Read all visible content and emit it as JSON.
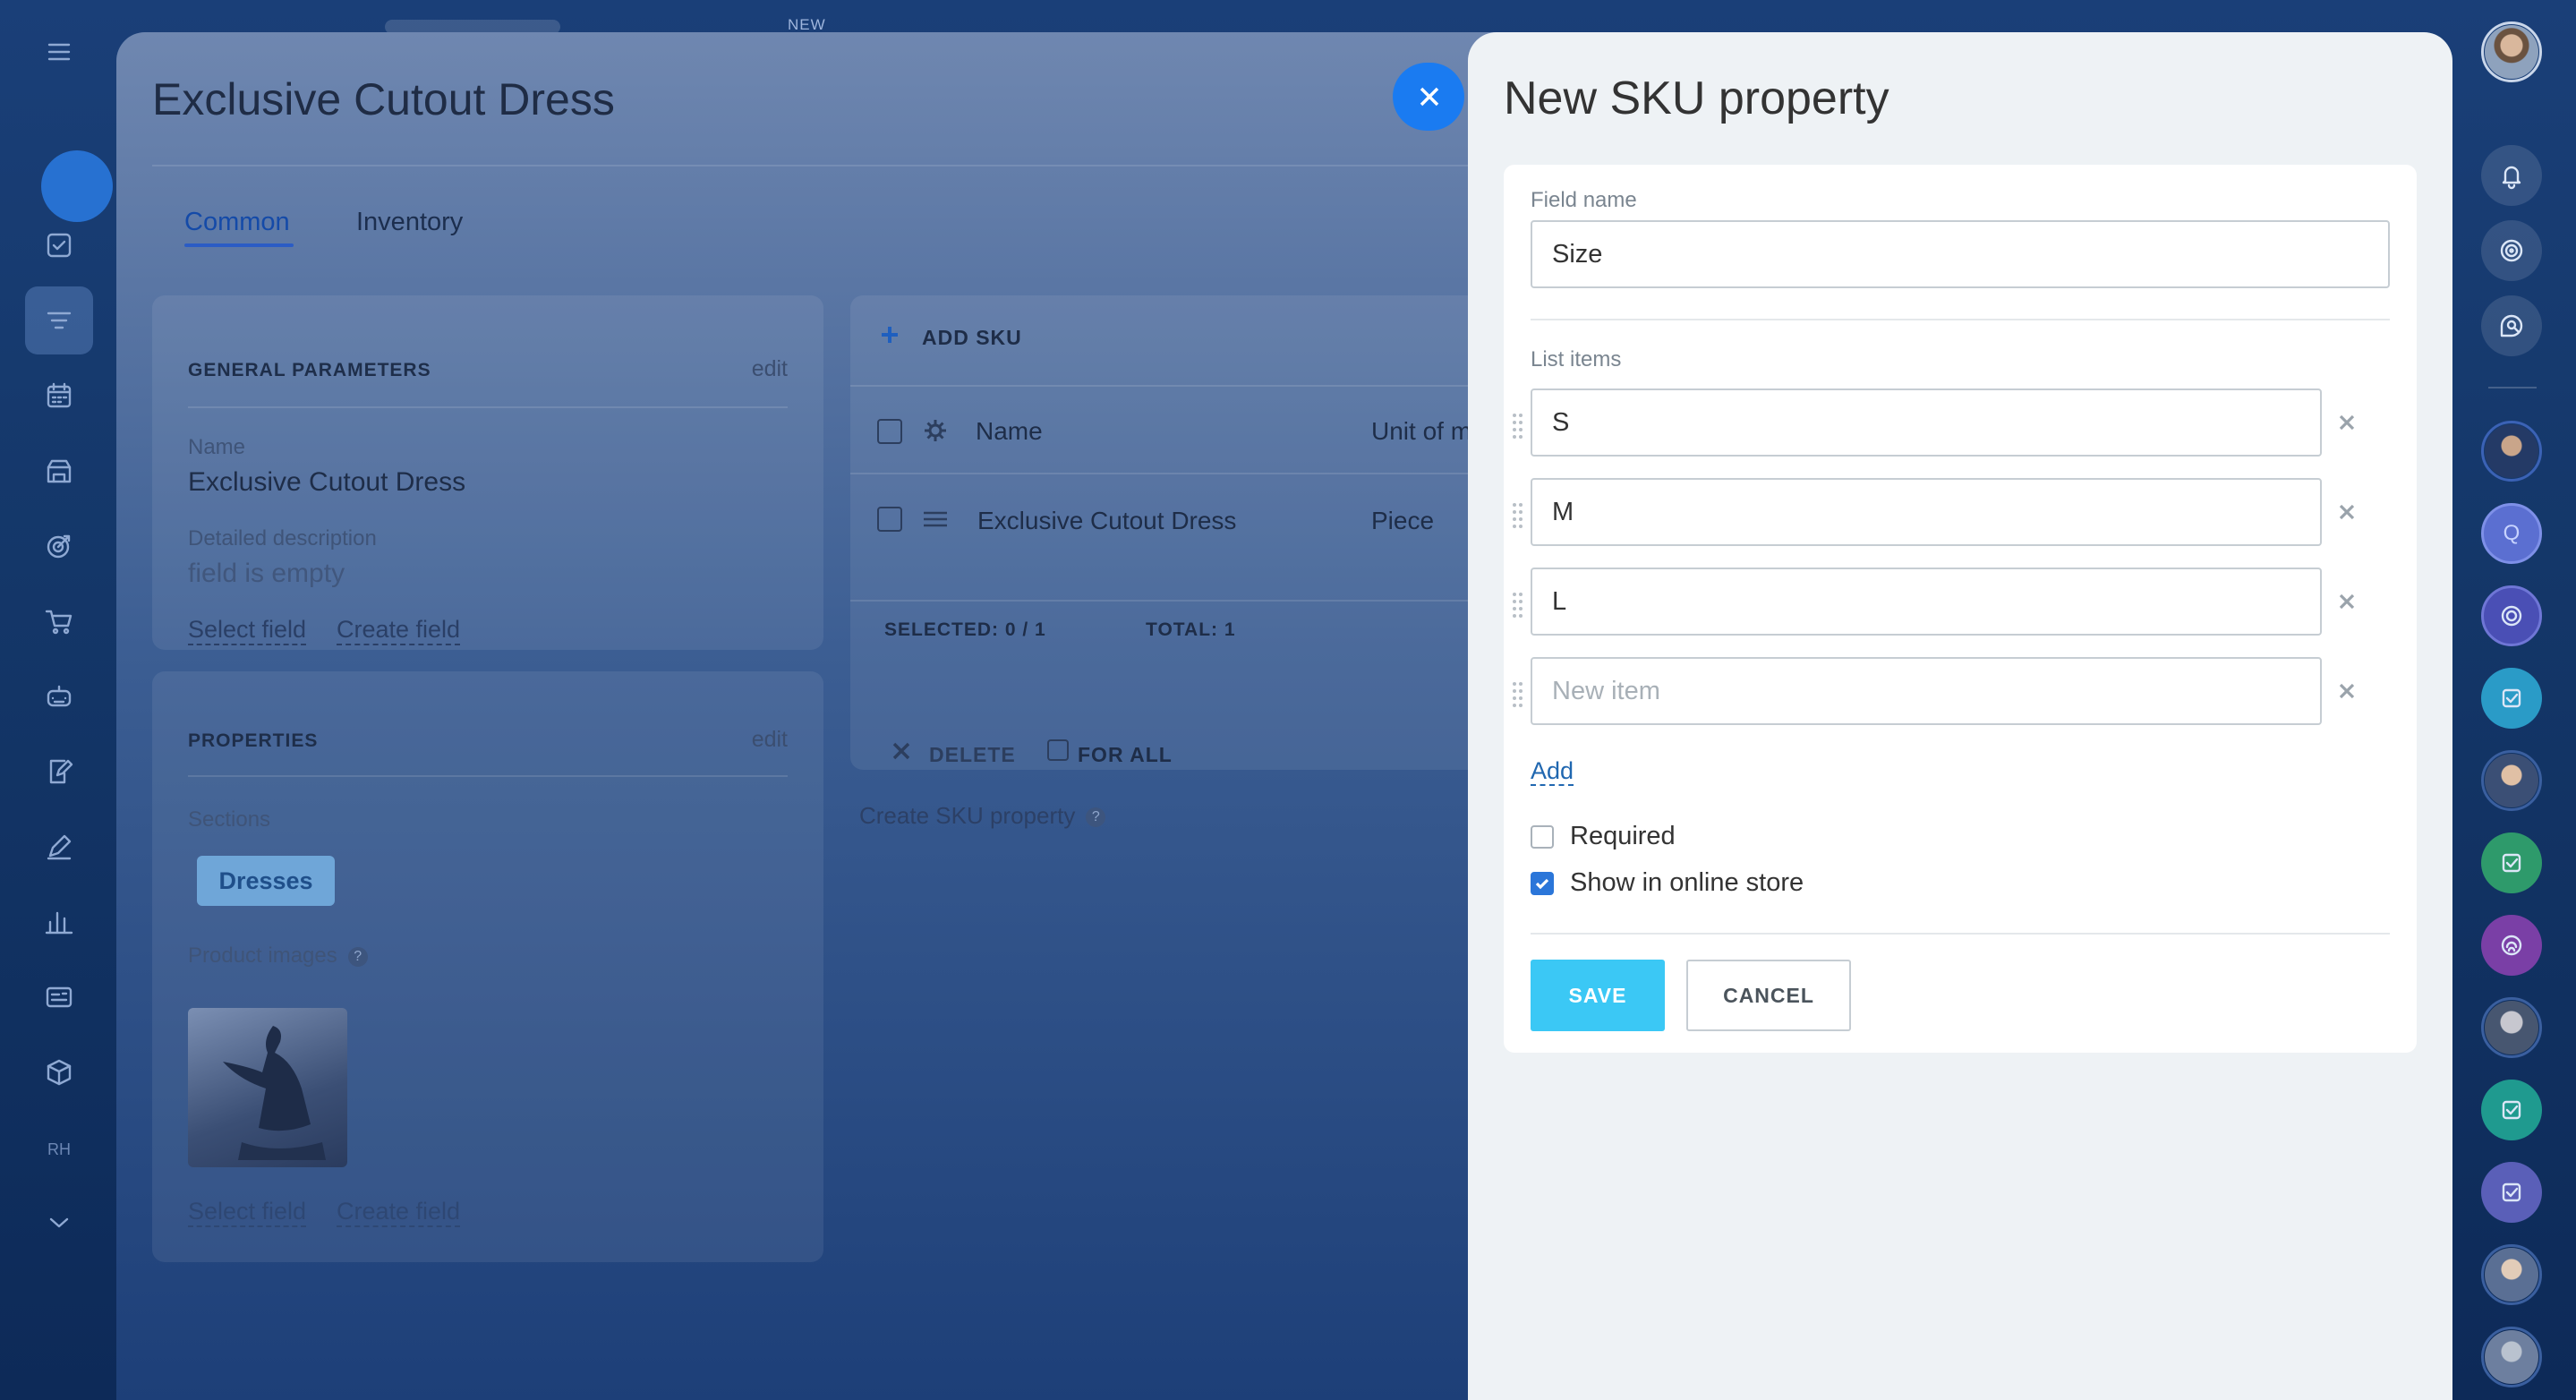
{
  "app": {
    "new_tag": "NEW"
  },
  "leftnav": {
    "items": [
      "menu-icon",
      "close-icon",
      "tasks-icon",
      "filter-icon",
      "calendar-icon",
      "store-icon",
      "target-icon",
      "cart-icon",
      "robot-icon",
      "edit-doc-icon",
      "pen-icon",
      "chart-icon",
      "id-card-icon",
      "box-icon",
      "rh-badge",
      "chevron-down-icon"
    ],
    "rh_label": "RH"
  },
  "product": {
    "title": "Exclusive Cutout Dress",
    "tabs": [
      {
        "label": "Common"
      },
      {
        "label": "Inventory"
      }
    ],
    "general": {
      "header": "GENERAL PARAMETERS",
      "edit": "edit",
      "name_label": "Name",
      "name_value": "Exclusive Cutout Dress",
      "desc_label": "Detailed description",
      "desc_value": "field is empty",
      "select_field": "Select field",
      "create_field": "Create field"
    },
    "properties": {
      "header": "PROPERTIES",
      "edit": "edit",
      "sections_label": "Sections",
      "section_chip": "Dresses",
      "images_label": "Product images",
      "select_field": "Select field",
      "create_field": "Create field"
    },
    "sku": {
      "add_sku": "ADD SKU",
      "col_name": "Name",
      "col_unit": "Unit of m",
      "row_name": "Exclusive Cutout Dress",
      "row_unit": "Piece",
      "selected_label": "SELECTED:",
      "selected_value": "0 / 1",
      "total_label": "TOTAL:",
      "total_value": "1",
      "delete": "DELETE",
      "for_all": "FOR ALL",
      "create_prop": "Create SKU property"
    }
  },
  "slideover": {
    "title": "New SKU property",
    "field_name_label": "Field name",
    "field_name_value": "Size",
    "list_items_label": "List items",
    "items": [
      {
        "value": "S",
        "placeholder": ""
      },
      {
        "value": "M",
        "placeholder": ""
      },
      {
        "value": "L",
        "placeholder": ""
      },
      {
        "value": "",
        "placeholder": "New item"
      }
    ],
    "add": "Add",
    "required_label": "Required",
    "required_checked": false,
    "show_label": "Show in online store",
    "show_checked": true,
    "save": "SAVE",
    "cancel": "CANCEL",
    "accent": "#3bc8f5"
  },
  "rail": {
    "items": [
      "user-avatar",
      "bell-icon",
      "target-icon",
      "chat-search-icon",
      "contact-avatar",
      "contact-q",
      "contact-target",
      "contact-task",
      "contact-avatar",
      "contact-task",
      "contact-fingerprint",
      "contact-avatar",
      "contact-task",
      "contact-task",
      "contact-avatar",
      "contact-avatar"
    ],
    "q_letter": "Q"
  }
}
